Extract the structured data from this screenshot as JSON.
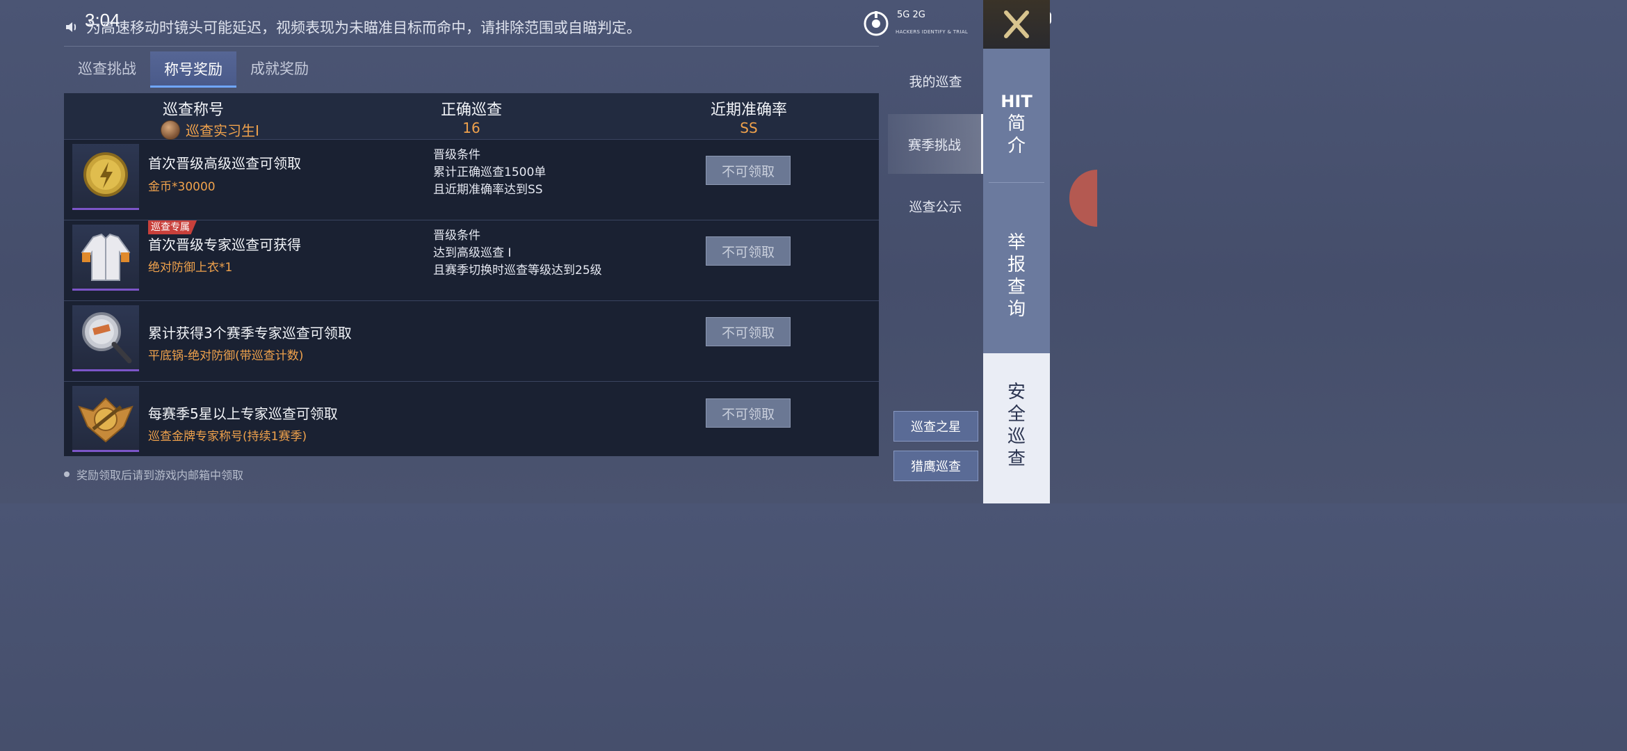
{
  "status_bar": {
    "time": "3:04",
    "signal_text": "5G  2G"
  },
  "notice": {
    "text": "为高速移动时镜头可能延迟，视频表现为未瞄准目标而命中，请排除范围或自瞄判定。"
  },
  "logo": {
    "text": "HACKERS IDENTIFY & TRIAL"
  },
  "tabs": [
    {
      "label": "巡查挑战"
    },
    {
      "label": "称号奖励"
    },
    {
      "label": "成就奖励"
    }
  ],
  "header": {
    "col1_label": "巡查称号",
    "col1_value": "巡查实习生Ⅰ",
    "col2_label": "正确巡查",
    "col2_value": "16",
    "col3_label": "近期准确率",
    "col3_value": "SS"
  },
  "rows": [
    {
      "title": "首次晋级高级巡查可领取",
      "reward": "金币*30000",
      "cond1": "晋级条件",
      "cond2": "累计正确巡查1500单",
      "cond3": "且近期准确率达到SS",
      "button": "不可领取"
    },
    {
      "tag": "巡查专属",
      "title": "首次晋级专家巡查可获得",
      "reward": "绝对防御上衣*1",
      "cond1": "晋级条件",
      "cond2": "达到高级巡查 I",
      "cond3": "且赛季切换时巡查等级达到25级",
      "button": "不可领取"
    },
    {
      "title": "累计获得3个赛季专家巡查可领取",
      "reward": "平底锅-绝对防御(带巡查计数)",
      "button": "不可领取"
    },
    {
      "title": "每赛季5星以上专家巡查可领取",
      "reward": "巡查金牌专家称号(持续1赛季)",
      "button": "不可领取"
    }
  ],
  "footnote": "奖励领取后请到游戏内邮箱中领取",
  "menu": [
    {
      "label": "我的巡查"
    },
    {
      "label": "赛季挑战"
    },
    {
      "label": "巡查公示"
    }
  ],
  "side_buttons": [
    {
      "label": "巡查之星"
    },
    {
      "label": "猎鹰巡查"
    }
  ],
  "vnav": [
    {
      "label_l1": "HIT",
      "label_l2": "简",
      "label_l3": "介"
    },
    {
      "label_l1": "举",
      "label_l2": "报",
      "label_l3": "查",
      "label_l4": "询"
    },
    {
      "label_l1": "安",
      "label_l2": "全",
      "label_l3": "巡",
      "label_l4": "查"
    }
  ],
  "colors": {
    "accent_orange": "#f0a24c",
    "tag_red": "#c8403b",
    "panel_bg": "#1a2132"
  }
}
